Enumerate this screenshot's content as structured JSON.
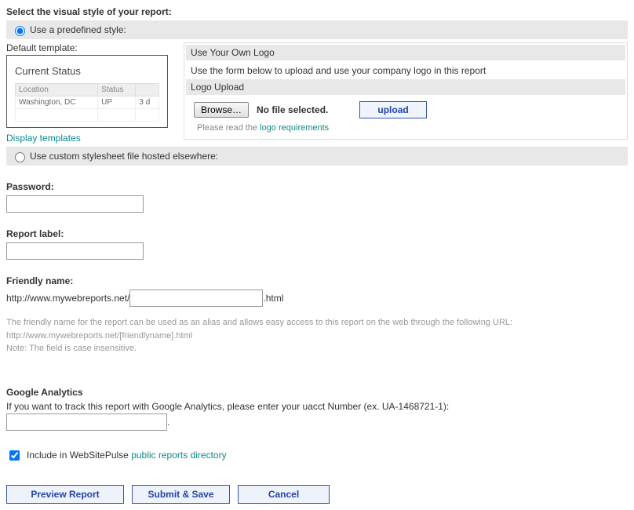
{
  "heading": "Select the visual style of your report:",
  "style": {
    "predefined_label": "Use a predefined style:",
    "custom_label": "Use custom stylesheet file hosted elsewhere:",
    "default_template_label": "Default template:",
    "display_templates_link": "Display templates",
    "preview": {
      "title": "Current Status",
      "col1": "Location",
      "col2": "Status",
      "row1_col1": "Washington, DC",
      "row1_col2": "UP",
      "row1_col3": "3 d"
    },
    "logo": {
      "use_own_logo": "Use Your Own Logo",
      "instruction": "Use the form below to upload and use your company logo in this report",
      "logo_upload_label": "Logo Upload",
      "browse_label": "Browse…",
      "no_file": "No file selected.",
      "upload_label": "upload",
      "hint_prefix": "Please read the ",
      "hint_link": "logo requirements"
    }
  },
  "password_label": "Password:",
  "report_label_label": "Report label:",
  "friendly": {
    "label": "Friendly name:",
    "prefix": "http://www.mywebreports.net/",
    "suffix": ".html",
    "desc1": "The friendly name for the report can be used as an alias and allows easy access to this report on the web through the following URL:",
    "desc2": "http://www.mywebreports.net/[friendlyname].html",
    "desc3": "Note: The field is case insensitive."
  },
  "ga": {
    "heading": "Google Analytics",
    "desc": "If you want to track this report with Google Analytics, please enter your uacct Number (ex. UA-1468721-1):"
  },
  "include": {
    "text": "Include in WebSitePulse ",
    "link": "public reports directory"
  },
  "actions": {
    "preview": "Preview  Report",
    "submit": "Submit & Save",
    "cancel": "Cancel"
  }
}
